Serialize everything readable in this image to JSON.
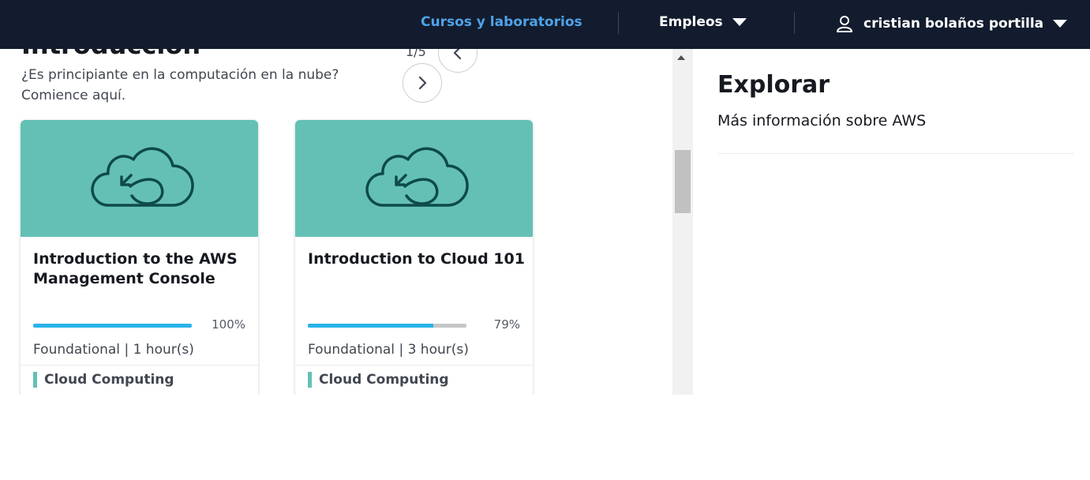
{
  "header": {
    "courses_label": "Cursos y laboratorios",
    "jobs_label": "Empleos",
    "user_name": "cristian bolaños portilla"
  },
  "section": {
    "title": "Introducción",
    "subtitle": "¿Es principiante en la computación en la nube? Comience aquí.",
    "page_indicator": "1/5"
  },
  "cards": [
    {
      "title": "Introduction to the AWS Management Console",
      "progress": 100,
      "progress_label": "100%",
      "meta": "Foundational | 1 hour(s)",
      "tag": "Cloud Computing"
    },
    {
      "title": "Introduction to Cloud 101",
      "progress": 79,
      "progress_label": "79%",
      "meta": "Foundational | 3 hour(s)",
      "tag": "Cloud Computing"
    }
  ],
  "explore": {
    "title": "Explorar",
    "subtitle": "Más información sobre AWS"
  },
  "colors": {
    "topbar": "#131c2e",
    "accent_link": "#4fa3e8",
    "card_hero": "#64c0b5",
    "progress": "#2ab3e8"
  },
  "icons": [
    "user-icon",
    "caret-down-icon",
    "chevron-left-icon",
    "chevron-right-icon",
    "cloud-icon"
  ]
}
